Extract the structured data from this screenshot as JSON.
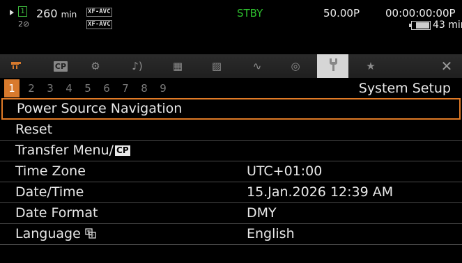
{
  "status": {
    "slot1": "1",
    "slot2": "2",
    "remaining_value": "260",
    "remaining_unit": "min",
    "format1": "XF-AVC",
    "format2": "XF-AVC",
    "mode": "STBY",
    "frame_rate": "50.00P",
    "timecode": "00:00:00:00P",
    "battery_value": "43",
    "battery_unit": "min",
    "mode_color": "#2ec02e",
    "battery_level": 0.75
  },
  "tabs": [
    {
      "icon": "camera-icon",
      "glyph": "▪▬"
    },
    {
      "icon": "custom-picture-icon",
      "glyph": "CP"
    },
    {
      "icon": "recording-setup-icon",
      "glyph": "⚙"
    },
    {
      "icon": "audio-icon",
      "glyph": "♪)"
    },
    {
      "icon": "video-setup-icon",
      "glyph": "▦"
    },
    {
      "icon": "lcd-viewfinder-icon",
      "glyph": "▨"
    },
    {
      "icon": "assistance-functions-icon",
      "glyph": "∿"
    },
    {
      "icon": "network-icon",
      "glyph": "◎"
    },
    {
      "icon": "system-setup-icon",
      "glyph": "🔧"
    },
    {
      "icon": "my-menu-star-icon",
      "glyph": "★"
    }
  ],
  "close_glyph": "✕",
  "pages": [
    "1",
    "2",
    "3",
    "4",
    "5",
    "6",
    "7",
    "8",
    "9"
  ],
  "active_page": 0,
  "section_title": "System Setup",
  "menu": [
    {
      "label": "Power Source Navigation",
      "value": ""
    },
    {
      "label": "Reset",
      "value": ""
    },
    {
      "label": "Transfer Menu/",
      "value": "",
      "badge": "CP"
    },
    {
      "label": "Time Zone",
      "value": "UTC+01:00"
    },
    {
      "label": "Date/Time",
      "value": "15.Jan.2026 12:39 AM"
    },
    {
      "label": "Date Format",
      "value": "DMY"
    },
    {
      "label": "Language",
      "value": "English"
    }
  ],
  "accent": "#d87a2d"
}
